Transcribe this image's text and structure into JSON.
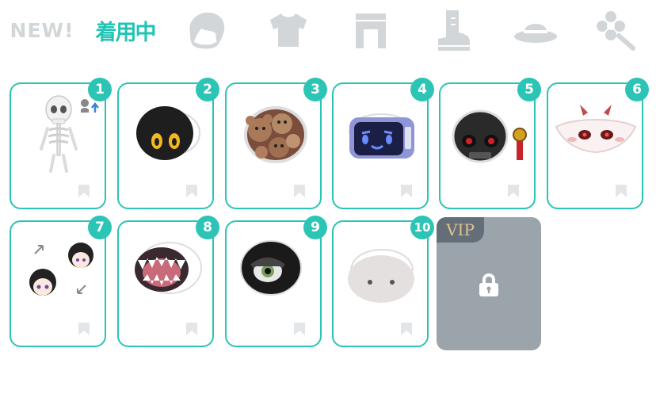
{
  "tabs": {
    "new_label": "NEW!",
    "wearing_label": "着用中",
    "categories": [
      "hair-icon",
      "shirt-icon",
      "pants-icon",
      "boots-icon",
      "hat-icon",
      "accessory-icon"
    ],
    "active": "wearing"
  },
  "items": [
    {
      "number": "1",
      "name": "skeleton-body"
    },
    {
      "number": "2",
      "name": "black-blob-face"
    },
    {
      "number": "3",
      "name": "teddy-bears-head"
    },
    {
      "number": "4",
      "name": "robot-tv-head"
    },
    {
      "number": "5",
      "name": "black-skull-head"
    },
    {
      "number": "6",
      "name": "white-horned-mask"
    },
    {
      "number": "7",
      "name": "black-hair-swap-head"
    },
    {
      "number": "8",
      "name": "monster-mouth-head"
    },
    {
      "number": "9",
      "name": "cyclops-eye-head"
    },
    {
      "number": "10",
      "name": "plain-face-head"
    }
  ],
  "vip": {
    "label": "VIP",
    "locked": true
  },
  "colors": {
    "accent": "#2cc4b4",
    "inactive_tab": "#d2d6d8",
    "vip_background": "#9ca4ab",
    "vip_label": "#e2c28e"
  }
}
